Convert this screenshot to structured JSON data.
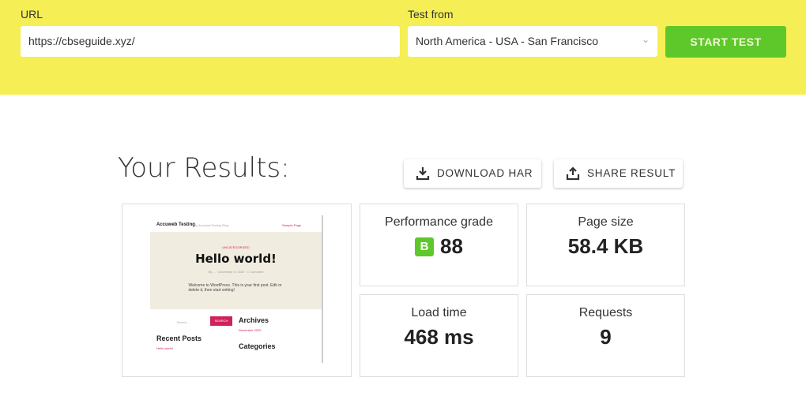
{
  "form": {
    "url_label": "URL",
    "url_value": "https://cbseguide.xyz/",
    "test_from_label": "Test from",
    "location": "North America - USA - San Francisco",
    "start_label": "START TEST"
  },
  "results": {
    "title": "Your Results:",
    "download_har": "DOWNLOAD HAR",
    "share_result": "SHARE RESULT",
    "performance_label": "Performance grade",
    "performance_grade": "B",
    "performance_score": "88",
    "page_size_label": "Page size",
    "page_size": "58.4 KB",
    "load_time_label": "Load time",
    "load_time": "468 ms",
    "requests_label": "Requests",
    "requests": "9"
  },
  "thumbnail": {
    "site": "Accuweb Testing",
    "tagline": "My AccuwebTesting Blog",
    "nav": "Sample Page",
    "category": "UNCATEGORIZED",
    "post_title": "Hello world!",
    "meta": "By ... · December 5, 2020 · 1 Comment",
    "body": "Welcome to WordPress. This is your first post. Edit or delete it, then start writing!",
    "search_placeholder": "Search ...",
    "search_btn": "SEARCH",
    "archives": "Archives",
    "archive_item": "December 2020",
    "recent": "Recent Posts",
    "recent_item": "Hello world!",
    "categories": "Categories"
  },
  "colors": {
    "banner": "#f5ee55",
    "accent": "#5ec82b"
  }
}
